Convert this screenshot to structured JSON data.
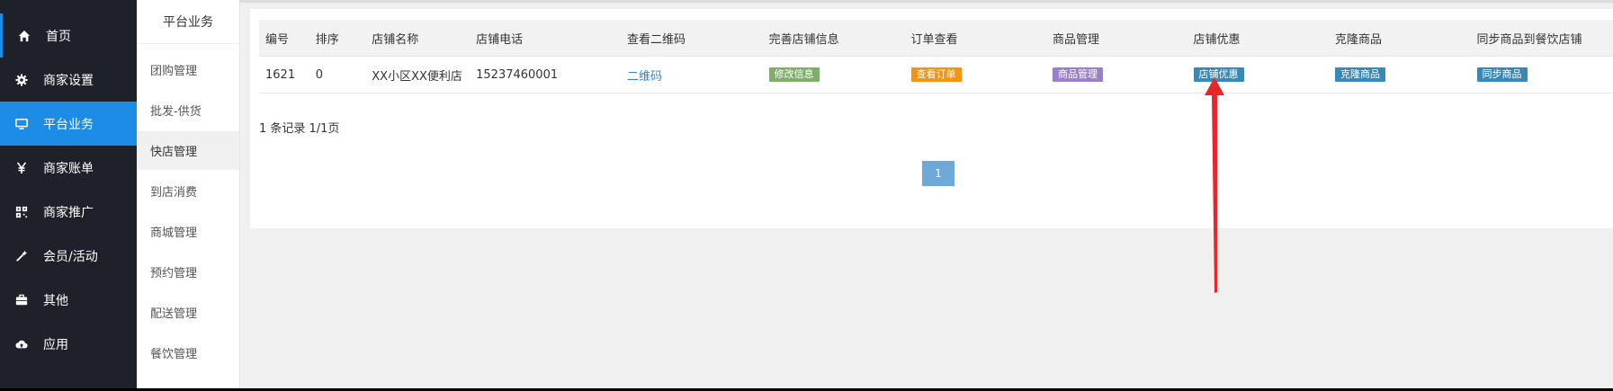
{
  "nav": {
    "items": [
      {
        "label": "首页",
        "icon": "home-icon"
      },
      {
        "label": "商家设置",
        "icon": "gear-icon"
      },
      {
        "label": "平台业务",
        "icon": "monitor-icon"
      },
      {
        "label": "商家账单",
        "icon": "yen-icon"
      },
      {
        "label": "商家推广",
        "icon": "qrcode-icon"
      },
      {
        "label": "会员/活动",
        "icon": "magic-wand-icon"
      },
      {
        "label": "其他",
        "icon": "briefcase-icon"
      },
      {
        "label": "应用",
        "icon": "cloud-upload-icon"
      }
    ]
  },
  "sub": {
    "title": "平台业务",
    "items": [
      "团购管理",
      "批发-供货",
      "快店管理",
      "到店消费",
      "商城管理",
      "预约管理",
      "配送管理",
      "餐饮管理"
    ]
  },
  "table": {
    "headers": [
      "编号",
      "排序",
      "店铺名称",
      "店铺电话",
      "查看二维码",
      "完善店铺信息",
      "订单查看",
      "商品管理",
      "店铺优惠",
      "克隆商品",
      "同步商品到餐饮店铺"
    ],
    "row": {
      "id": "1621",
      "sort": "0",
      "name": "XX小区XX便利店",
      "phone": "15237460001",
      "qrcode": "二维码",
      "edit_info": "修改信息",
      "view_orders": "查看订单",
      "goods_manage": "商品管理",
      "store_discount": "店铺优惠",
      "clone_goods": "克隆商品",
      "sync_goods": "同步商品"
    }
  },
  "records_text": "1 条记录 1/1页",
  "pagination": {
    "current": "1"
  },
  "colors": {
    "nav_bg": "#1e2129",
    "accent": "#1c8ce6",
    "btn_green": "#7fb069",
    "btn_orange": "#f7930e",
    "btn_purple": "#9a7fca",
    "btn_blue": "#3689b8",
    "arrow": "#e8262a"
  }
}
